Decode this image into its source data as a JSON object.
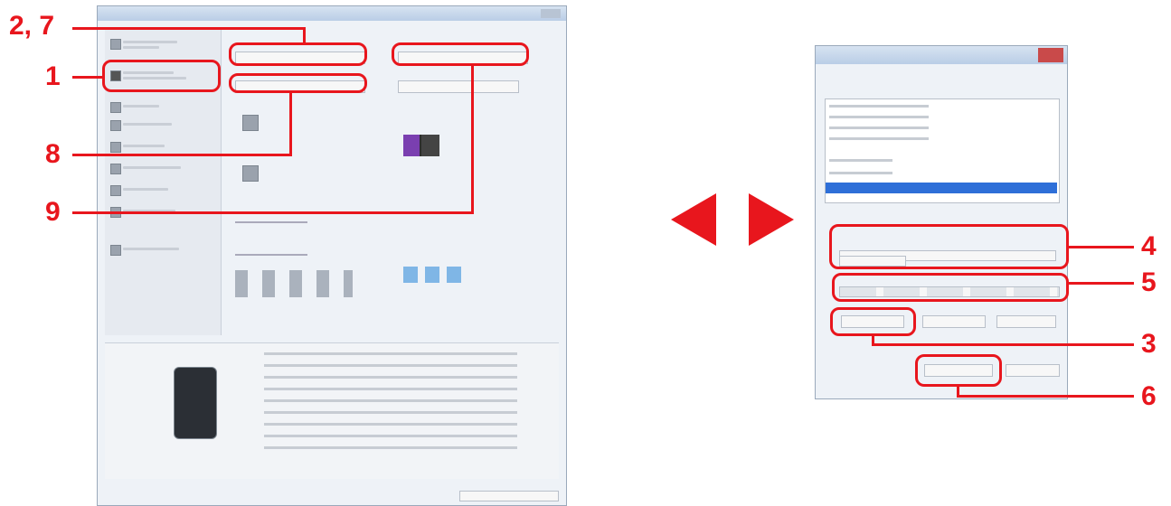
{
  "callouts": {
    "c1": "1",
    "c27": "2, 7",
    "c8": "8",
    "c9": "9",
    "c4": "4",
    "c5": "5",
    "c3": "3",
    "c6": "6"
  },
  "colors": {
    "callout": "#e8161d",
    "window_bg": "#eef2f7",
    "selection": "#2e6fd8"
  },
  "icons": {
    "left_arrow": "triangle-left-icon",
    "right_arrow": "triangle-right-icon",
    "printer": "printer-icon",
    "close": "close-icon"
  }
}
